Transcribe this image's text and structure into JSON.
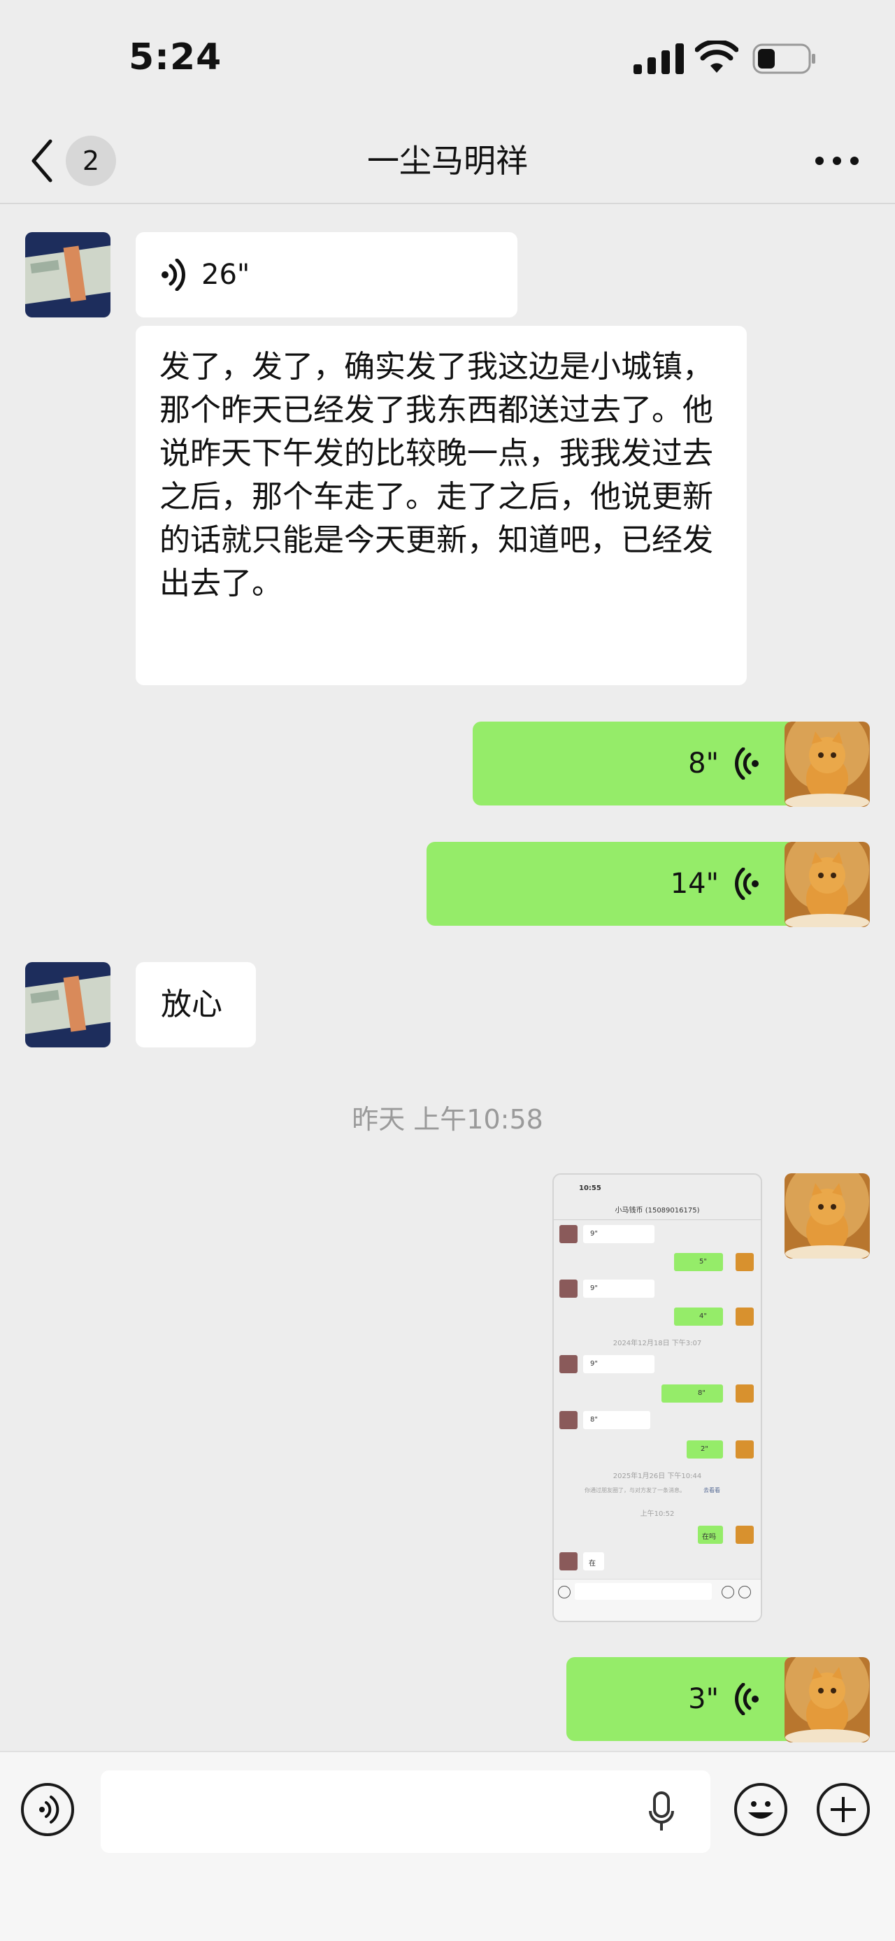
{
  "status": {
    "time": "5:24"
  },
  "nav": {
    "badge": "2",
    "title": "一尘马明祥"
  },
  "messages": {
    "voice1": "26\"",
    "text1": "发了，发了，确实发了我这边是小城镇，那个昨天已经发了我东西都送过去了。他说昨天下午发的比较晚一点，我我发过去之后，那个车走了。走了之后，他说更新的话就只能是今天更新，知道吧，已经发出去了。",
    "voice2": "8\"",
    "voice3": "14\"",
    "text2": "放心",
    "timestamp": "昨天 上午10:58",
    "voice4": "3\""
  },
  "thumbnail": {
    "time": "10:55",
    "title": "小马钱币 (15089016175)",
    "v1": "9\"",
    "v2": "5\"",
    "v3": "9\"",
    "v4": "4\"",
    "ts1": "2024年12月18日 下午3:07",
    "v5": "9\"",
    "v6": "8\"",
    "v7": "8\"",
    "v8": "2\"",
    "ts2": "2025年1月26日 下午10:44",
    "notice": "你通过朋友圈了，与对方发了一条消息。",
    "notice_link": "去看看",
    "ts3": "上午10:52",
    "m1": "在吗",
    "m2": "在"
  },
  "colors": {
    "green": "#95ec69",
    "background": "#ededed"
  }
}
